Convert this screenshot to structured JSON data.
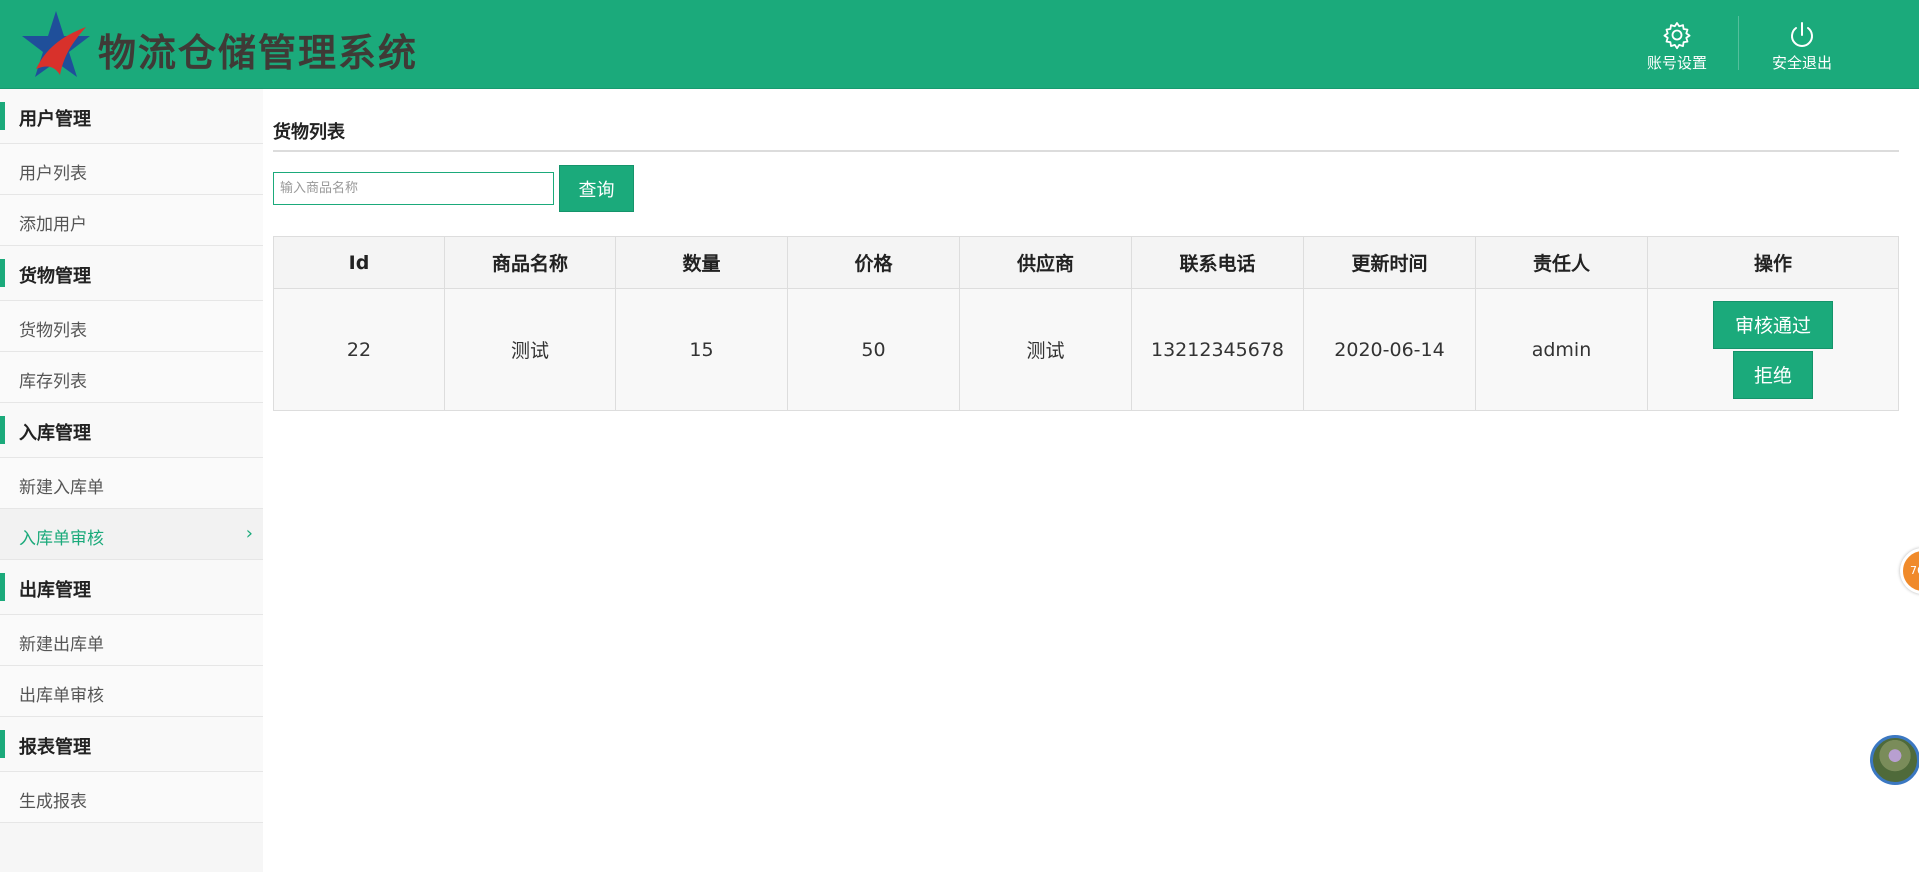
{
  "header": {
    "app_title": "物流仓储管理系统",
    "account_settings_label": "账号设置",
    "logout_label": "安全退出",
    "brand_color": "#1baa7b"
  },
  "sidebar": {
    "groups": [
      {
        "label": "用户管理",
        "items": [
          {
            "label": "用户列表"
          },
          {
            "label": "添加用户"
          }
        ]
      },
      {
        "label": "货物管理",
        "items": [
          {
            "label": "货物列表"
          },
          {
            "label": "库存列表"
          }
        ]
      },
      {
        "label": "入库管理",
        "items": [
          {
            "label": "新建入库单"
          },
          {
            "label": "入库单审核",
            "active": true
          }
        ]
      },
      {
        "label": "出库管理",
        "items": [
          {
            "label": "新建出库单"
          },
          {
            "label": "出库单审核"
          }
        ]
      },
      {
        "label": "报表管理",
        "items": [
          {
            "label": "生成报表"
          }
        ]
      }
    ]
  },
  "main": {
    "page_title": "货物列表",
    "search": {
      "placeholder": "输入商品名称",
      "value": "",
      "button_label": "查询"
    },
    "table": {
      "columns": [
        "Id",
        "商品名称",
        "数量",
        "价格",
        "供应商",
        "联系电话",
        "更新时间",
        "责任人",
        "操作"
      ],
      "rows": [
        {
          "id": "22",
          "name": "测试",
          "quantity": "15",
          "price": "50",
          "supplier": "测试",
          "phone": "13212345678",
          "updated": "2020-06-14",
          "owner": "admin",
          "approve_label": "审核通过",
          "reject_label": "拒绝"
        }
      ]
    }
  },
  "floating": {
    "badge_text": "76"
  }
}
